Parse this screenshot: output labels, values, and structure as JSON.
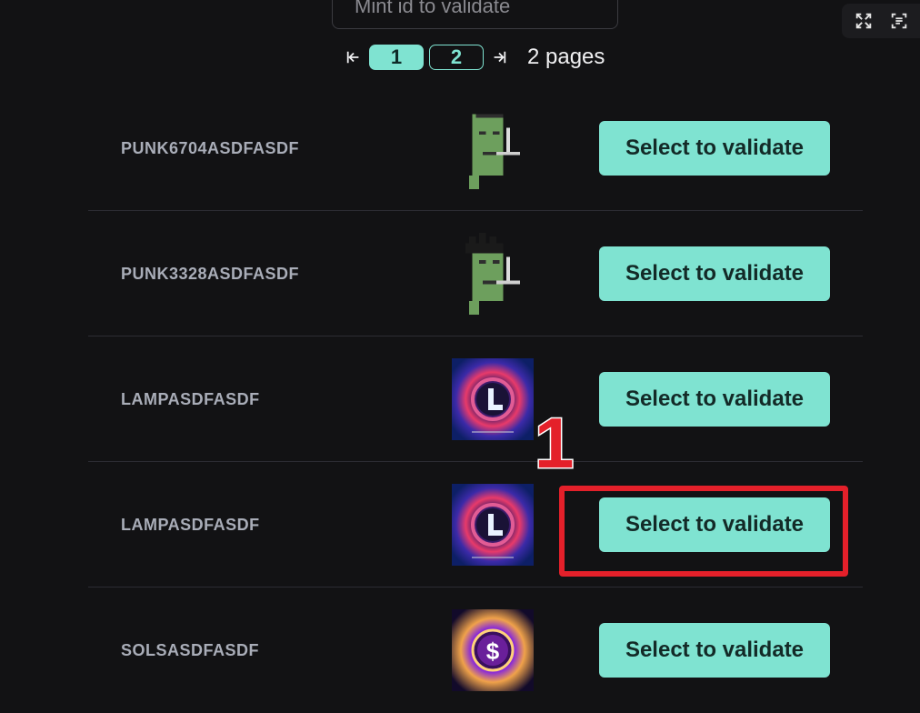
{
  "search": {
    "placeholder": "Mint id to validate"
  },
  "pagination": {
    "pages": [
      "1",
      "2"
    ],
    "current": "1",
    "summary": "2 pages"
  },
  "items": [
    {
      "name": "PUNK6704ASDFASDF",
      "image": "pixel-punk-pipe",
      "action": "Select to validate"
    },
    {
      "name": "PUNK3328ASDFASDF",
      "image": "pixel-punk-messy-hair",
      "action": "Select to validate"
    },
    {
      "name": "LAMPASDFASDF",
      "image": "cosmic-L-logo",
      "action": "Select to validate"
    },
    {
      "name": "LAMPASDFASDF",
      "image": "cosmic-L-logo",
      "action": "Select to validate"
    },
    {
      "name": "SOLSASDFASDF",
      "image": "cosmic-dollar-logo",
      "action": "Select to validate"
    }
  ],
  "annotation": {
    "label": "1",
    "color": "#e4202a"
  },
  "colors": {
    "accent": "#7fe3d1",
    "background": "#121214",
    "divider": "#2c2c33"
  }
}
